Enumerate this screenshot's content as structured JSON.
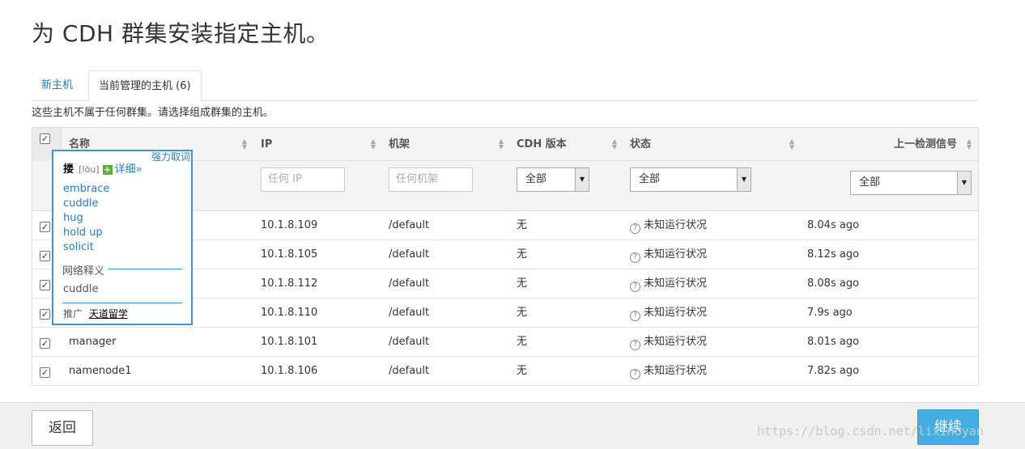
{
  "page": {
    "title": "为 CDH 群集安装指定主机。"
  },
  "tabs": [
    {
      "label": "新主机"
    },
    {
      "label": "当前管理的主机 (6)"
    }
  ],
  "intro_text": "这些主机不属于任何群集。请选择组成群集的主机。",
  "table": {
    "select_all_checked": true,
    "columns": {
      "name": "名称",
      "ip": "IP",
      "rack": "机架",
      "cdh_version": "CDH 版本",
      "status": "状态",
      "last_heartbeat": "上一检测信号"
    },
    "filters": {
      "ip_placeholder": "任何 IP",
      "rack_placeholder": "任何机架",
      "cdh_version_selected": "全部",
      "status_selected": "全部",
      "heartbeat_selected": "全部"
    },
    "rows": [
      {
        "name": "",
        "ip": "10.1.8.109",
        "rack": "/default",
        "cdh": "无",
        "status": "未知运行状况",
        "heartbeat": "8.04s ago",
        "checked": true
      },
      {
        "name": "",
        "ip": "10.1.8.105",
        "rack": "/default",
        "cdh": "无",
        "status": "未知运行状况",
        "heartbeat": "8.12s ago",
        "checked": true
      },
      {
        "name": "",
        "ip": "10.1.8.112",
        "rack": "/default",
        "cdh": "无",
        "status": "未知运行状况",
        "heartbeat": "8.08s ago",
        "checked": true
      },
      {
        "name": "",
        "ip": "10.1.8.110",
        "rack": "/default",
        "cdh": "无",
        "status": "未知运行状况",
        "heartbeat": "7.9s ago",
        "checked": true
      },
      {
        "name": "manager",
        "ip": "10.1.8.101",
        "rack": "/default",
        "cdh": "无",
        "status": "未知运行状况",
        "heartbeat": "8.01s ago",
        "checked": true
      },
      {
        "name": "namenode1",
        "ip": "10.1.8.106",
        "rack": "/default",
        "cdh": "无",
        "status": "未知运行状况",
        "heartbeat": "7.82s ago",
        "checked": true
      }
    ]
  },
  "popup": {
    "close_label": "强力取词",
    "word": "搂",
    "phonetic": "[lōu]",
    "detail_link": "详细»",
    "meanings": [
      "embrace",
      "cuddle",
      "hug",
      "hold up",
      "solicit"
    ],
    "web_section": "网络释义",
    "web_meaning": "cuddle",
    "promo_label": "推广",
    "promo_link": "天道留学"
  },
  "footer": {
    "back_label": "返回",
    "next_label": "继续"
  },
  "watermark": "https://blog.csdn.net/lixinoyan"
}
